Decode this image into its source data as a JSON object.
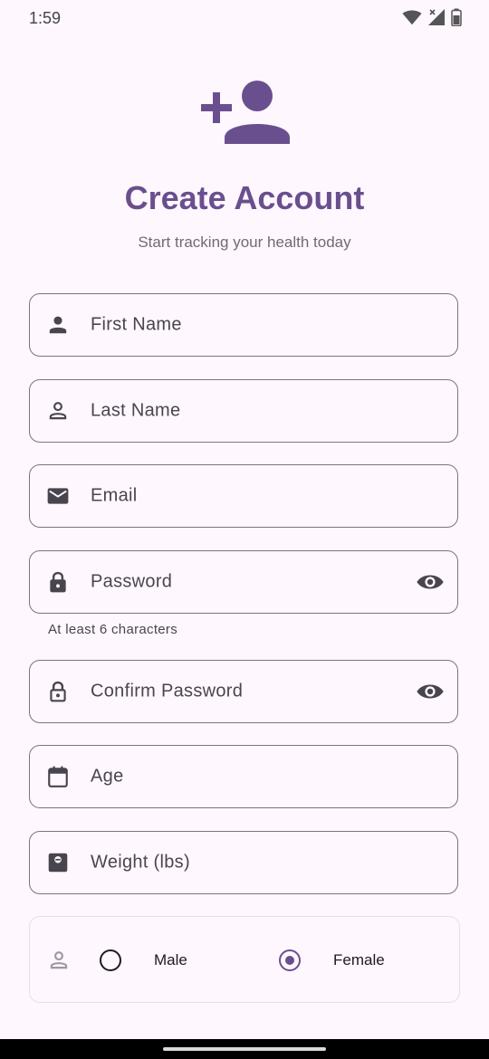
{
  "status_bar": {
    "time": "1:59",
    "icons": [
      "wifi-icon",
      "signal-icon",
      "battery-icon"
    ]
  },
  "header": {
    "icon": "person-add-icon",
    "title": "Create Account",
    "subtitle": "Start tracking your health today"
  },
  "form": {
    "first_name": {
      "label": "First Name",
      "icon": "person-icon"
    },
    "last_name": {
      "label": "Last Name",
      "icon": "person-outline-icon"
    },
    "email": {
      "label": "Email",
      "icon": "mail-icon"
    },
    "password": {
      "label": "Password",
      "icon": "lock-icon",
      "helper": "At least 6 characters",
      "toggle_icon": "eye-icon"
    },
    "confirm_password": {
      "label": "Confirm Password",
      "icon": "lock-outline-icon",
      "toggle_icon": "eye-icon"
    },
    "age": {
      "label": "Age",
      "icon": "calendar-icon"
    },
    "weight": {
      "label": "Weight (lbs)",
      "icon": "scale-icon"
    },
    "gender": {
      "icon": "person-outline-icon",
      "options": [
        {
          "label": "Male",
          "selected": false
        },
        {
          "label": "Female",
          "selected": true
        }
      ]
    }
  },
  "colors": {
    "primary": "#6a4f8e",
    "background": "#fef7fe",
    "outline": "#79747e",
    "on_surface": "#1d1b20",
    "on_surface_variant": "#49454f"
  }
}
